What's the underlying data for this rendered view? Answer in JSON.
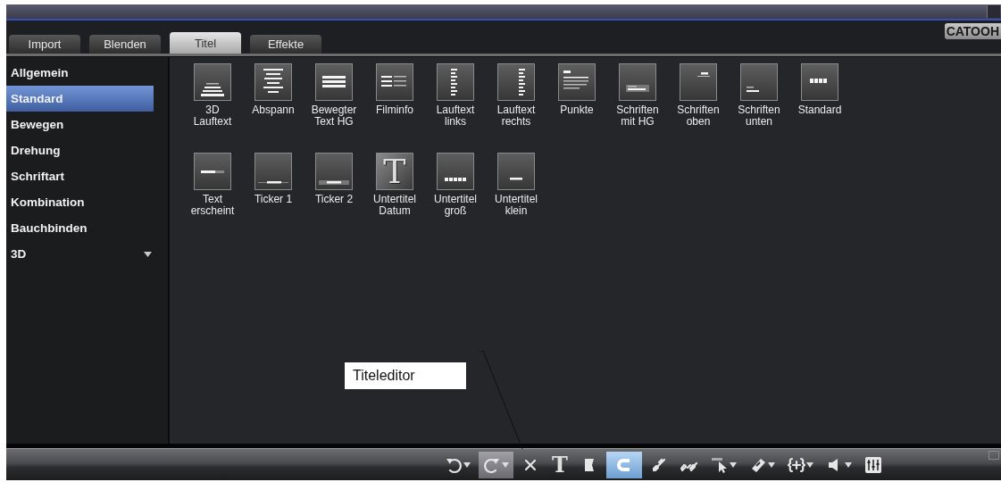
{
  "window": {
    "restore": true
  },
  "tabs": [
    {
      "label": "Import",
      "selected": false
    },
    {
      "label": "Blenden",
      "selected": false
    },
    {
      "label": "Titel",
      "selected": true
    },
    {
      "label": "Effekte",
      "selected": false
    }
  ],
  "logo": "CATOOH",
  "sidebar": {
    "items": [
      {
        "label": "Allgemein",
        "selected": false
      },
      {
        "label": "Standard",
        "selected": true
      },
      {
        "label": "Bewegen",
        "selected": false
      },
      {
        "label": "Drehung",
        "selected": false
      },
      {
        "label": "Schriftart",
        "selected": false
      },
      {
        "label": "Kombination",
        "selected": false
      },
      {
        "label": "Bauchbinden",
        "selected": false
      },
      {
        "label": "3D",
        "selected": false,
        "submenu": true
      }
    ]
  },
  "templates": [
    {
      "label": "3D\nLauftext",
      "kind": "perspective"
    },
    {
      "label": "Abspann",
      "kind": "credits"
    },
    {
      "label": "Bewegter\nText HG",
      "kind": "band"
    },
    {
      "label": "Filminfo",
      "kind": "info"
    },
    {
      "label": "Lauftext\nlinks",
      "kind": "scroll-left"
    },
    {
      "label": "Lauftext\nrechts",
      "kind": "scroll-right"
    },
    {
      "label": "Punkte",
      "kind": "points"
    },
    {
      "label": "Schriften\nmit HG",
      "kind": "boxed"
    },
    {
      "label": "Schriften\noben",
      "kind": "top"
    },
    {
      "label": "Schriften\nunten",
      "kind": "bottom"
    },
    {
      "label": "Standard",
      "kind": "blocks"
    },
    {
      "label": "Text\nerscheint",
      "kind": "appear"
    },
    {
      "label": "Ticker 1",
      "kind": "ticker"
    },
    {
      "label": "Ticker 2",
      "kind": "ticker-box"
    },
    {
      "label": "Untertitel\nDatum",
      "kind": "glyph",
      "glyph": "T"
    },
    {
      "label": "Untertitel\ngroß",
      "kind": "blocks-low"
    },
    {
      "label": "Untertitel\nklein",
      "kind": "dash"
    }
  ],
  "callout": {
    "label": "Titeleditor"
  },
  "toolbar": [
    {
      "kind": "undo",
      "menu": true,
      "highlighted": false,
      "on": false
    },
    {
      "kind": "redo",
      "menu": true,
      "highlighted": true,
      "on": false
    },
    {
      "kind": "delete",
      "menu": false,
      "highlighted": false,
      "on": false
    },
    {
      "kind": "title",
      "glyph": "T",
      "menu": false,
      "highlighted": false,
      "on": false
    },
    {
      "kind": "marker",
      "menu": false,
      "highlighted": false,
      "on": false
    },
    {
      "kind": "magnet",
      "menu": false,
      "highlighted": false,
      "on": true
    },
    {
      "kind": "link",
      "menu": false,
      "highlighted": false,
      "on": false
    },
    {
      "kind": "unlink",
      "menu": false,
      "highlighted": false,
      "on": false
    },
    {
      "kind": "pointer",
      "menu": true,
      "highlighted": false,
      "on": false
    },
    {
      "kind": "razor",
      "menu": true,
      "highlighted": false,
      "on": false
    },
    {
      "kind": "group",
      "menu": true,
      "highlighted": false,
      "on": false
    },
    {
      "kind": "speaker",
      "menu": true,
      "highlighted": false,
      "on": false
    },
    {
      "kind": "mixer",
      "menu": false,
      "highlighted": false,
      "on": false
    }
  ]
}
